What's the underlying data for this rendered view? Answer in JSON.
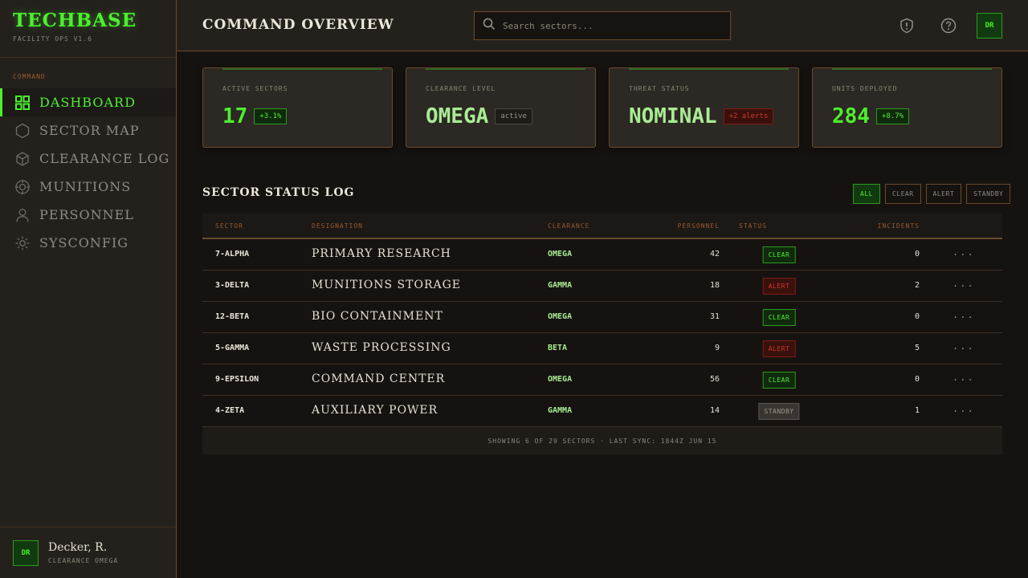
{
  "brand": {
    "name": "TECHBASE",
    "subtitle": "FACILITY OPS V1.6"
  },
  "sidebar": {
    "section_label": "COMMAND",
    "items": [
      {
        "label": "DASHBOARD",
        "icon": "grid-icon",
        "active": true
      },
      {
        "label": "SECTOR MAP",
        "icon": "hexagon-icon",
        "active": false
      },
      {
        "label": "CLEARANCE LOG",
        "icon": "cube-icon",
        "active": false
      },
      {
        "label": "MUNITIONS",
        "icon": "crosshair-icon",
        "active": false
      },
      {
        "label": "PERSONNEL",
        "icon": "person-icon",
        "active": false
      },
      {
        "label": "SYSCONFIG",
        "icon": "gear-icon",
        "active": false
      }
    ],
    "user": {
      "initials": "DR",
      "name": "Decker, R.",
      "role": "CLEARANCE OMEGA"
    }
  },
  "header": {
    "title": "COMMAND OVERVIEW",
    "search_placeholder": "Search sectors...",
    "icons": [
      "alert-shield-icon",
      "help-icon"
    ],
    "avatar_initials": "DR"
  },
  "stats": [
    {
      "label": "ACTIVE SECTORS",
      "value": "17",
      "badge": "+3.1%",
      "badge_tone": "green"
    },
    {
      "label": "CLEARANCE LEVEL",
      "value": "OMEGA",
      "badge": "active",
      "badge_tone": "gray"
    },
    {
      "label": "THREAT STATUS",
      "value": "NOMINAL",
      "badge": "+2 alerts",
      "badge_tone": "red"
    },
    {
      "label": "UNITS DEPLOYED",
      "value": "284",
      "badge": "+8.7%",
      "badge_tone": "green"
    }
  ],
  "table": {
    "title": "SECTOR STATUS LOG",
    "filters": [
      "ALL",
      "CLEAR",
      "ALERT",
      "STANDBY"
    ],
    "active_filter": "ALL",
    "columns": [
      "SECTOR",
      "DESIGNATION",
      "CLEARANCE",
      "PERSONNEL",
      "STATUS",
      "INCIDENTS"
    ],
    "rows": [
      {
        "sector": "7-ALPHA",
        "designation": "PRIMARY RESEARCH",
        "clearance": "OMEGA",
        "personnel": "42",
        "status": "CLEAR",
        "incidents": "0"
      },
      {
        "sector": "3-DELTA",
        "designation": "MUNITIONS STORAGE",
        "clearance": "GAMMA",
        "personnel": "18",
        "status": "ALERT",
        "incidents": "2"
      },
      {
        "sector": "12-BETA",
        "designation": "BIO CONTAINMENT",
        "clearance": "OMEGA",
        "personnel": "31",
        "status": "CLEAR",
        "incidents": "0"
      },
      {
        "sector": "5-GAMMA",
        "designation": "WASTE PROCESSING",
        "clearance": "BETA",
        "personnel": "9",
        "status": "ALERT",
        "incidents": "5"
      },
      {
        "sector": "9-EPSILON",
        "designation": "COMMAND CENTER",
        "clearance": "OMEGA",
        "personnel": "56",
        "status": "CLEAR",
        "incidents": "0"
      },
      {
        "sector": "4-ZETA",
        "designation": "AUXILIARY POWER",
        "clearance": "GAMMA",
        "personnel": "14",
        "status": "STANDBY",
        "incidents": "1"
      }
    ],
    "row_menu": "...",
    "footer": "SHOWING 6 OF 29 SECTORS · LAST SYNC: 1844Z JUN 15"
  },
  "colors": {
    "accent": "#4cf02e",
    "background": "#161210",
    "panel": "#24211d",
    "border": "#6a4a2c",
    "alert": "#d03a2a"
  }
}
